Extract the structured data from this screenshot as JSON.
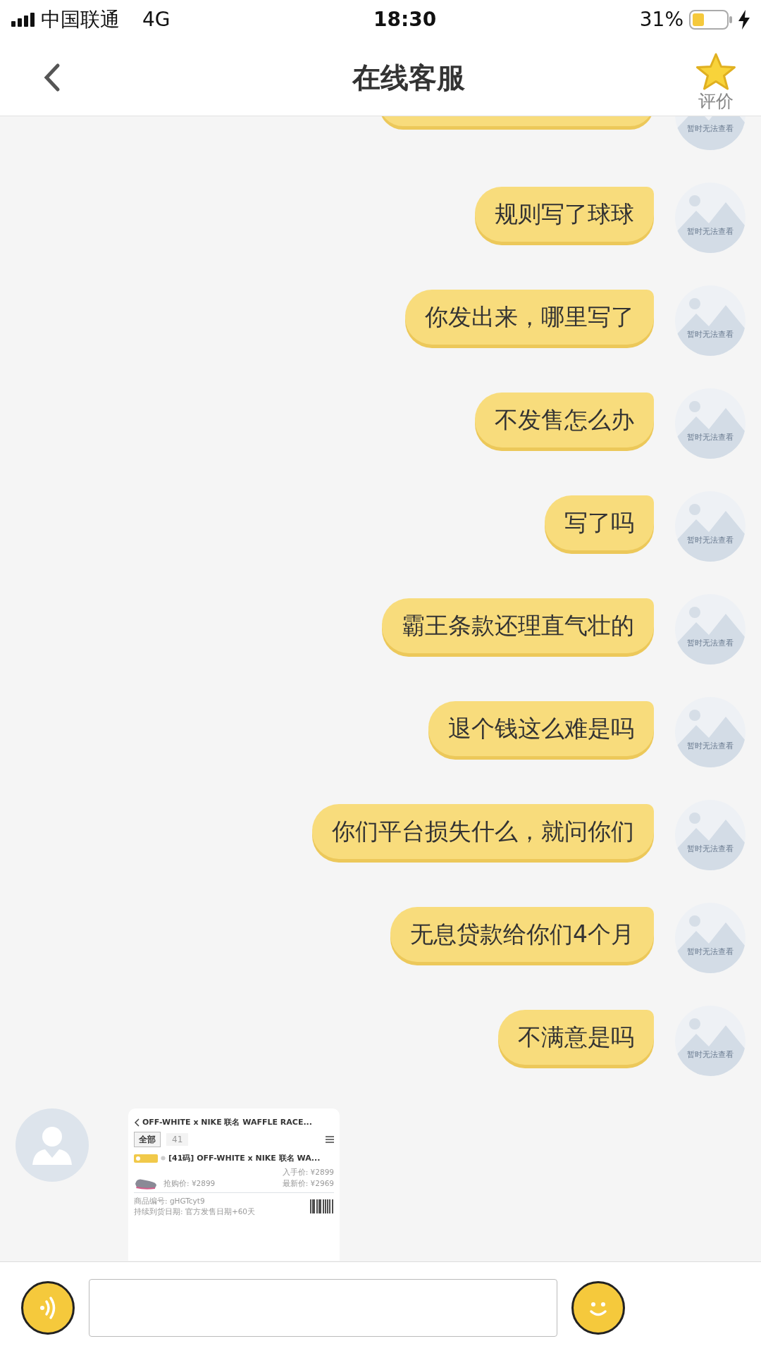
{
  "status_bar": {
    "carrier": "中国联通",
    "network": "4G",
    "time": "18:30",
    "battery": "31%"
  },
  "header": {
    "title": "在线客服",
    "rate_label": "评价"
  },
  "messages": [
    {
      "kind": "partial",
      "outgoing": true,
      "avatar_caption": "暂时无法查看"
    },
    {
      "kind": "text",
      "outgoing": true,
      "text": "规则写了球球",
      "avatar_caption": "暂时无法查看"
    },
    {
      "kind": "text",
      "outgoing": true,
      "text": "你发出来，哪里写了",
      "avatar_caption": "暂时无法查看"
    },
    {
      "kind": "text",
      "outgoing": true,
      "text": "不发售怎么办",
      "avatar_caption": "暂时无法查看"
    },
    {
      "kind": "text",
      "outgoing": true,
      "text": "写了吗",
      "avatar_caption": "暂时无法查看"
    },
    {
      "kind": "text",
      "outgoing": true,
      "text": "霸王条款还理直气壮的",
      "avatar_caption": "暂时无法查看"
    },
    {
      "kind": "text",
      "outgoing": true,
      "text": "退个钱这么难是吗",
      "avatar_caption": "暂时无法查看"
    },
    {
      "kind": "text",
      "outgoing": true,
      "text": "你们平台损失什么，就问你们",
      "avatar_caption": "暂时无法查看"
    },
    {
      "kind": "text",
      "outgoing": true,
      "text": "无息贷款给你们4个月",
      "avatar_caption": "暂时无法查看"
    },
    {
      "kind": "text",
      "outgoing": true,
      "text": "不满意是吗",
      "avatar_caption": "暂时无法查看"
    },
    {
      "kind": "image",
      "outgoing": false,
      "screenshot": {
        "title": "OFF-WHITE x NIKE 联名 WAFFLE RACE...",
        "filter_all": "全部",
        "shoe_size_chip": "41",
        "item_title": "[41码] OFF-WHITE x NIKE 联名 WA...",
        "buy_price": "入手价: ¥2899",
        "sale_price": "抢购价: ¥2899",
        "latest_price": "最新价: ¥2969",
        "product_code": "商品编号: gHGTcyt9",
        "delivery": "持续到货日期: 官方发售日期+60天"
      }
    }
  ]
}
